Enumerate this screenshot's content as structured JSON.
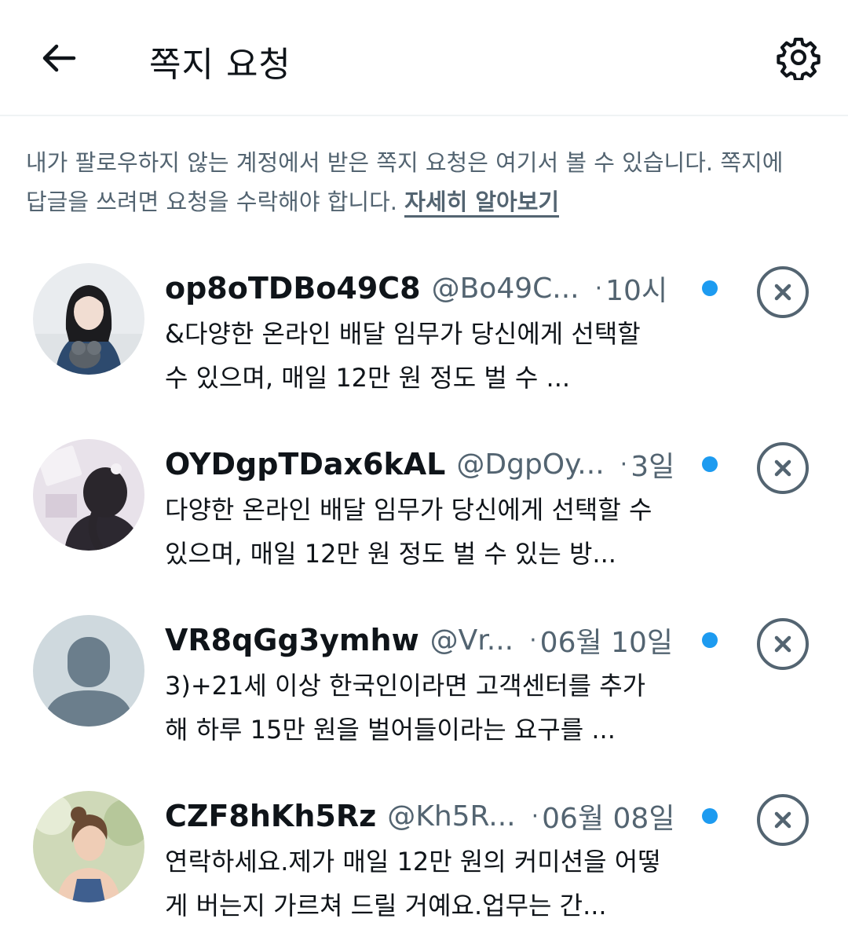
{
  "header": {
    "back_icon": "arrow-left-icon",
    "title": "쪽지 요청",
    "settings_icon": "gear-icon"
  },
  "notice": {
    "text": "내가 팔로우하지 않는 계정에서 받은 쪽지 요청은 여기서 볼 수 있습니다. 쪽지에 답글을 쓰려면 요청을 수락해야 합니다. ",
    "link": "자세히 알아보기"
  },
  "requests": [
    {
      "name": "op8oTDBo49C8",
      "handle": "@Bo49C...",
      "separator": "·",
      "time": "10시",
      "preview": "&다양한 온라인 배달 임무가 당신에게 선택할 수 있으며, 매일 12만 원 정도 벌 수 ...",
      "unread": true
    },
    {
      "name": "OYDgpTDax6kAL",
      "handle": "@DgpOy...",
      "separator": "·",
      "time": "3일",
      "preview": "다양한 온라인 배달 임무가 당신에게 선택할 수 있으며, 매일 12만 원 정도 벌 수 있는 방...",
      "unread": true
    },
    {
      "name": "VR8qGg3ymhw",
      "handle": "@Vr...",
      "separator": "·",
      "time": "06월 10일",
      "preview": "3)+21세 이상 한국인이라면 고객센터를 추가해 하루 15만 원을 벌어들이라는 요구를 ...",
      "unread": true
    },
    {
      "name": "CZF8hKh5Rz",
      "handle": "@Kh5R...",
      "separator": "·",
      "time": "06월 08일",
      "preview": "연락하세요.제가 매일 12만 원의 커미션을 어떻게 버는지 가르쳐 드릴 거예요.업무는 간...",
      "unread": true
    }
  ],
  "colors": {
    "primary_text": "#0f1419",
    "secondary_text": "#536471",
    "accent": "#1d9bf0",
    "divider": "#eff3f4"
  }
}
